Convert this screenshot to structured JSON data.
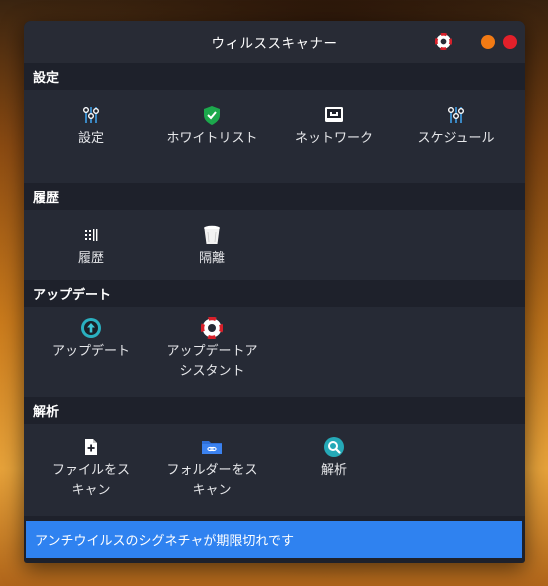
{
  "window": {
    "title": "ウィルススキャナー"
  },
  "sections": [
    {
      "header": "設定",
      "items": [
        {
          "label": "設定",
          "icon": "sliders-icon"
        },
        {
          "label": "ホワイトリスト",
          "icon": "shield-check-icon"
        },
        {
          "label": "ネットワーク",
          "icon": "network-icon"
        },
        {
          "label": "スケジュール",
          "icon": "schedule-sliders-icon"
        }
      ]
    },
    {
      "header": "履歴",
      "items": [
        {
          "label": "履歴",
          "icon": "history-list-icon"
        },
        {
          "label": "隔離",
          "icon": "trash-bin-icon"
        }
      ]
    },
    {
      "header": "アップデート",
      "items": [
        {
          "label": "アップデート",
          "icon": "update-arrow-icon"
        },
        {
          "label": "アップデートアシスタント",
          "icon": "lifebuoy-icon"
        }
      ]
    },
    {
      "header": "解析",
      "items": [
        {
          "label": "ファイルをスキャン",
          "icon": "file-plus-icon"
        },
        {
          "label": "フォルダーをスキャン",
          "icon": "folder-link-icon"
        },
        {
          "label": "解析",
          "icon": "magnifier-icon"
        }
      ]
    }
  ],
  "status": {
    "message": "アンチウイルスのシグネチャが期限切れです"
  },
  "colors": {
    "accent": "#2f82f0",
    "window_bg": "#1e212b",
    "section_bg": "#262a35",
    "minimize": "#f27a14",
    "close": "#e3202a"
  }
}
